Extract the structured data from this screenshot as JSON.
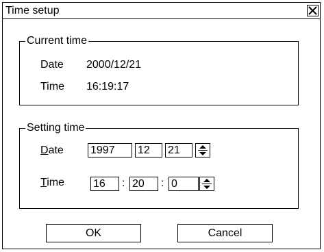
{
  "dialog": {
    "title": "Time setup",
    "close_icon": "close-x-icon"
  },
  "current_time": {
    "legend": "Current time",
    "date_label": "Date",
    "date_value": "2000/12/21",
    "time_label": "Time",
    "time_value": "16:19:17"
  },
  "setting_time": {
    "legend": "Setting time",
    "date_label_first": "D",
    "date_label_rest": "ate",
    "year": "1997",
    "month": "12",
    "day": "21",
    "time_label_first": "T",
    "time_label_rest": "ime",
    "hour": "16",
    "minute": "20",
    "second": "0",
    "separator": ":",
    "spin_icon": "up-down-spinner-icon"
  },
  "buttons": {
    "ok": "OK",
    "cancel": "Cancel"
  }
}
